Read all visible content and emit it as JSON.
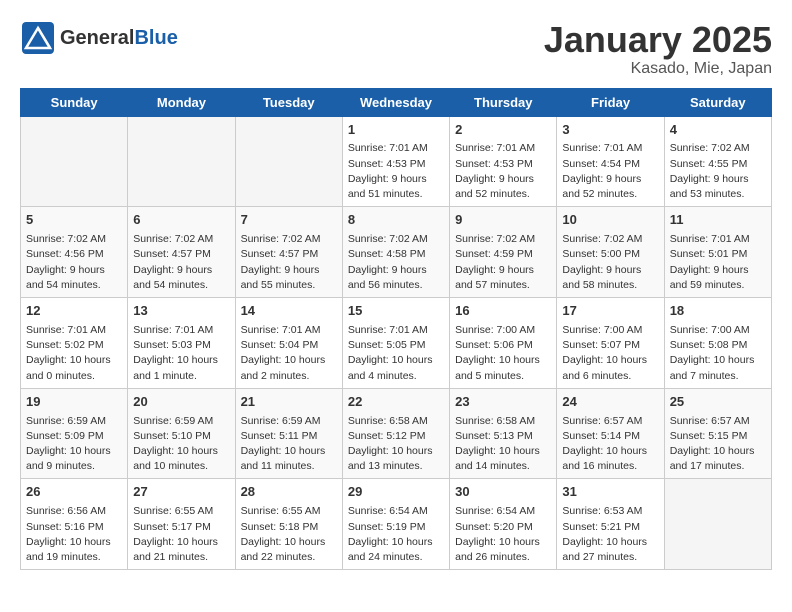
{
  "header": {
    "logo_general": "General",
    "logo_blue": "Blue",
    "title": "January 2025",
    "subtitle": "Kasado, Mie, Japan"
  },
  "weekdays": [
    "Sunday",
    "Monday",
    "Tuesday",
    "Wednesday",
    "Thursday",
    "Friday",
    "Saturday"
  ],
  "weeks": [
    [
      {
        "day": "",
        "info": ""
      },
      {
        "day": "",
        "info": ""
      },
      {
        "day": "",
        "info": ""
      },
      {
        "day": "1",
        "info": "Sunrise: 7:01 AM\nSunset: 4:53 PM\nDaylight: 9 hours and 51 minutes."
      },
      {
        "day": "2",
        "info": "Sunrise: 7:01 AM\nSunset: 4:53 PM\nDaylight: 9 hours and 52 minutes."
      },
      {
        "day": "3",
        "info": "Sunrise: 7:01 AM\nSunset: 4:54 PM\nDaylight: 9 hours and 52 minutes."
      },
      {
        "day": "4",
        "info": "Sunrise: 7:02 AM\nSunset: 4:55 PM\nDaylight: 9 hours and 53 minutes."
      }
    ],
    [
      {
        "day": "5",
        "info": "Sunrise: 7:02 AM\nSunset: 4:56 PM\nDaylight: 9 hours and 54 minutes."
      },
      {
        "day": "6",
        "info": "Sunrise: 7:02 AM\nSunset: 4:57 PM\nDaylight: 9 hours and 54 minutes."
      },
      {
        "day": "7",
        "info": "Sunrise: 7:02 AM\nSunset: 4:57 PM\nDaylight: 9 hours and 55 minutes."
      },
      {
        "day": "8",
        "info": "Sunrise: 7:02 AM\nSunset: 4:58 PM\nDaylight: 9 hours and 56 minutes."
      },
      {
        "day": "9",
        "info": "Sunrise: 7:02 AM\nSunset: 4:59 PM\nDaylight: 9 hours and 57 minutes."
      },
      {
        "day": "10",
        "info": "Sunrise: 7:02 AM\nSunset: 5:00 PM\nDaylight: 9 hours and 58 minutes."
      },
      {
        "day": "11",
        "info": "Sunrise: 7:01 AM\nSunset: 5:01 PM\nDaylight: 9 hours and 59 minutes."
      }
    ],
    [
      {
        "day": "12",
        "info": "Sunrise: 7:01 AM\nSunset: 5:02 PM\nDaylight: 10 hours and 0 minutes."
      },
      {
        "day": "13",
        "info": "Sunrise: 7:01 AM\nSunset: 5:03 PM\nDaylight: 10 hours and 1 minute."
      },
      {
        "day": "14",
        "info": "Sunrise: 7:01 AM\nSunset: 5:04 PM\nDaylight: 10 hours and 2 minutes."
      },
      {
        "day": "15",
        "info": "Sunrise: 7:01 AM\nSunset: 5:05 PM\nDaylight: 10 hours and 4 minutes."
      },
      {
        "day": "16",
        "info": "Sunrise: 7:00 AM\nSunset: 5:06 PM\nDaylight: 10 hours and 5 minutes."
      },
      {
        "day": "17",
        "info": "Sunrise: 7:00 AM\nSunset: 5:07 PM\nDaylight: 10 hours and 6 minutes."
      },
      {
        "day": "18",
        "info": "Sunrise: 7:00 AM\nSunset: 5:08 PM\nDaylight: 10 hours and 7 minutes."
      }
    ],
    [
      {
        "day": "19",
        "info": "Sunrise: 6:59 AM\nSunset: 5:09 PM\nDaylight: 10 hours and 9 minutes."
      },
      {
        "day": "20",
        "info": "Sunrise: 6:59 AM\nSunset: 5:10 PM\nDaylight: 10 hours and 10 minutes."
      },
      {
        "day": "21",
        "info": "Sunrise: 6:59 AM\nSunset: 5:11 PM\nDaylight: 10 hours and 11 minutes."
      },
      {
        "day": "22",
        "info": "Sunrise: 6:58 AM\nSunset: 5:12 PM\nDaylight: 10 hours and 13 minutes."
      },
      {
        "day": "23",
        "info": "Sunrise: 6:58 AM\nSunset: 5:13 PM\nDaylight: 10 hours and 14 minutes."
      },
      {
        "day": "24",
        "info": "Sunrise: 6:57 AM\nSunset: 5:14 PM\nDaylight: 10 hours and 16 minutes."
      },
      {
        "day": "25",
        "info": "Sunrise: 6:57 AM\nSunset: 5:15 PM\nDaylight: 10 hours and 17 minutes."
      }
    ],
    [
      {
        "day": "26",
        "info": "Sunrise: 6:56 AM\nSunset: 5:16 PM\nDaylight: 10 hours and 19 minutes."
      },
      {
        "day": "27",
        "info": "Sunrise: 6:55 AM\nSunset: 5:17 PM\nDaylight: 10 hours and 21 minutes."
      },
      {
        "day": "28",
        "info": "Sunrise: 6:55 AM\nSunset: 5:18 PM\nDaylight: 10 hours and 22 minutes."
      },
      {
        "day": "29",
        "info": "Sunrise: 6:54 AM\nSunset: 5:19 PM\nDaylight: 10 hours and 24 minutes."
      },
      {
        "day": "30",
        "info": "Sunrise: 6:54 AM\nSunset: 5:20 PM\nDaylight: 10 hours and 26 minutes."
      },
      {
        "day": "31",
        "info": "Sunrise: 6:53 AM\nSunset: 5:21 PM\nDaylight: 10 hours and 27 minutes."
      },
      {
        "day": "",
        "info": ""
      }
    ]
  ]
}
